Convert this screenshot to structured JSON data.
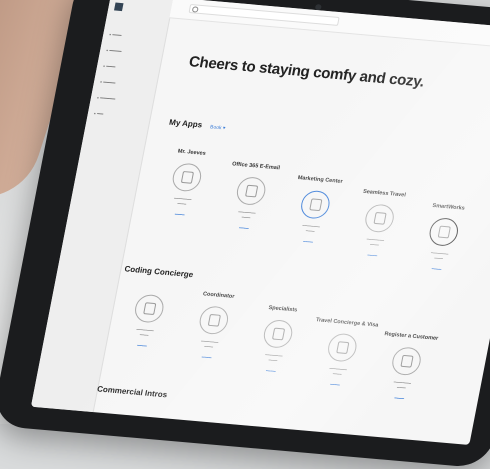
{
  "header": {
    "greeting": "Cheers to staying comfy and cozy."
  },
  "sections": {
    "my_apps": {
      "title": "My Apps",
      "link": "Book ▾"
    },
    "coding": {
      "title": "Coding Concierge"
    },
    "commercial": {
      "title": "Commercial Intros"
    }
  },
  "apps_row1": [
    "Mr. Jeeves",
    "Office 365 E-Email",
    "Marketing Center",
    "Seamless Travel",
    "SmartWorks"
  ],
  "apps_row2": [
    "Coordinator",
    "Specialists",
    "Travel Concierge & Visa",
    "Register a Customer"
  ],
  "colors": {
    "accent": "#3b7dd8",
    "bezel": "#1b1c1e"
  }
}
